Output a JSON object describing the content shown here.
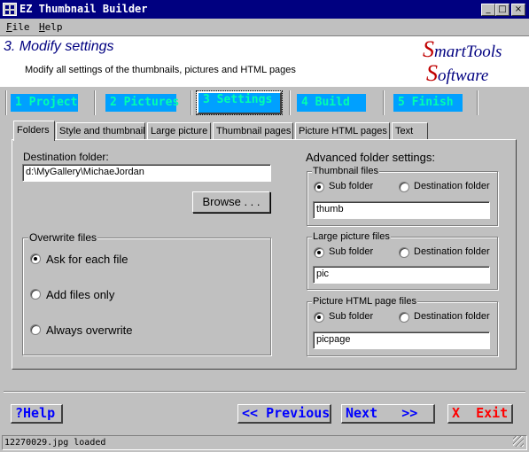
{
  "window": {
    "title": "EZ Thumbnail Builder",
    "minimize": "_",
    "maximize": "□",
    "close": "×"
  },
  "menu": {
    "file_first": "F",
    "file_rest": "ile",
    "help_first": "H",
    "help_rest": "elp"
  },
  "header": {
    "step_title": "3. Modify settings",
    "description": "Modify all settings of the thumbnails, pictures and HTML pages",
    "logo": {
      "s": "S",
      "mart": "martTools",
      "o": "S",
      "oftware": "oftware"
    }
  },
  "steps": [
    {
      "label": "1 Project"
    },
    {
      "label": "2 Pictures"
    },
    {
      "label": "3 Settings"
    },
    {
      "label": "4 Build"
    },
    {
      "label": "5 Finish"
    }
  ],
  "tabs": [
    {
      "label": "Folders"
    },
    {
      "label": "Style and thumbnail"
    },
    {
      "label": "Large picture"
    },
    {
      "label": "Thumbnail pages"
    },
    {
      "label": "Picture HTML pages"
    },
    {
      "label": "Text"
    }
  ],
  "folders": {
    "destination_label": "Destination folder:",
    "destination_value": "d:\\MyGallery\\MichaeJordan",
    "browse": "Browse . . .",
    "overwrite": {
      "title": "Overwrite files",
      "options": [
        "Ask for each file",
        "Add files only",
        "Always overwrite"
      ],
      "selected": "Ask for each file"
    },
    "advanced_label": "Advanced folder settings:",
    "groups": [
      {
        "title": "Thumbnail files",
        "opt1": "Sub folder",
        "opt2": "Destination folder",
        "selected": "Sub folder",
        "value": "thumb"
      },
      {
        "title": "Large picture files",
        "opt1": "Sub folder",
        "opt2": "Destination folder",
        "selected": "Sub folder",
        "value": "pic"
      },
      {
        "title": "Picture HTML page files",
        "opt1": "Sub folder",
        "opt2": "Destination folder",
        "selected": "Sub folder",
        "value": "picpage"
      }
    ]
  },
  "nav": {
    "help": "?Help",
    "previous": "<< Previous",
    "next": "Next   >>",
    "exit_x": "X",
    "exit": "Exit"
  },
  "status": "12270029.jpg loaded",
  "colors": {
    "titlebar": "#000080",
    "step_bg": "#00a0ff",
    "step_text": "#00ffb0",
    "nav_text": "#0000ff",
    "exit_red": "#ff0000"
  }
}
